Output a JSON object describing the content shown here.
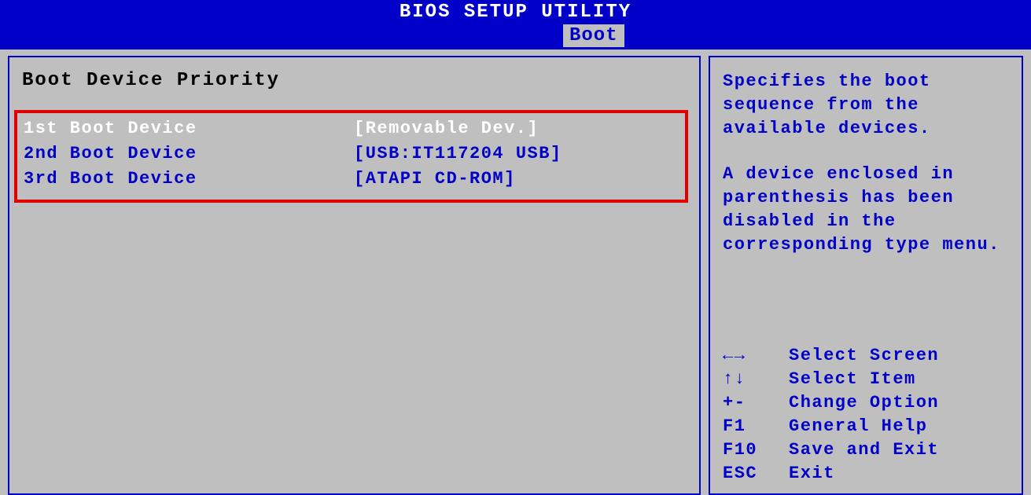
{
  "title": "BIOS SETUP UTILITY",
  "active_tab": "Boot",
  "main": {
    "section_title": "Boot Device Priority",
    "boot_items": [
      {
        "label": "1st Boot Device",
        "value": "[Removable Dev.]",
        "selected": true
      },
      {
        "label": "2nd Boot Device",
        "value": "[USB:IT117204 USB]",
        "selected": false
      },
      {
        "label": "3rd Boot Device",
        "value": "[ATAPI CD-ROM]",
        "selected": false
      }
    ]
  },
  "help": {
    "paragraph1": "Specifies the boot sequence from the available devices.",
    "paragraph2": "A device enclosed in parenthesis has been disabled in the corresponding type menu."
  },
  "keys": [
    {
      "sym": "←→",
      "desc": "Select Screen"
    },
    {
      "sym": "↑↓",
      "desc": "Select Item"
    },
    {
      "sym": "+-",
      "desc": "Change Option"
    },
    {
      "sym": "F1",
      "desc": "General Help"
    },
    {
      "sym": "F10",
      "desc": "Save and Exit"
    },
    {
      "sym": "ESC",
      "desc": "Exit"
    }
  ]
}
